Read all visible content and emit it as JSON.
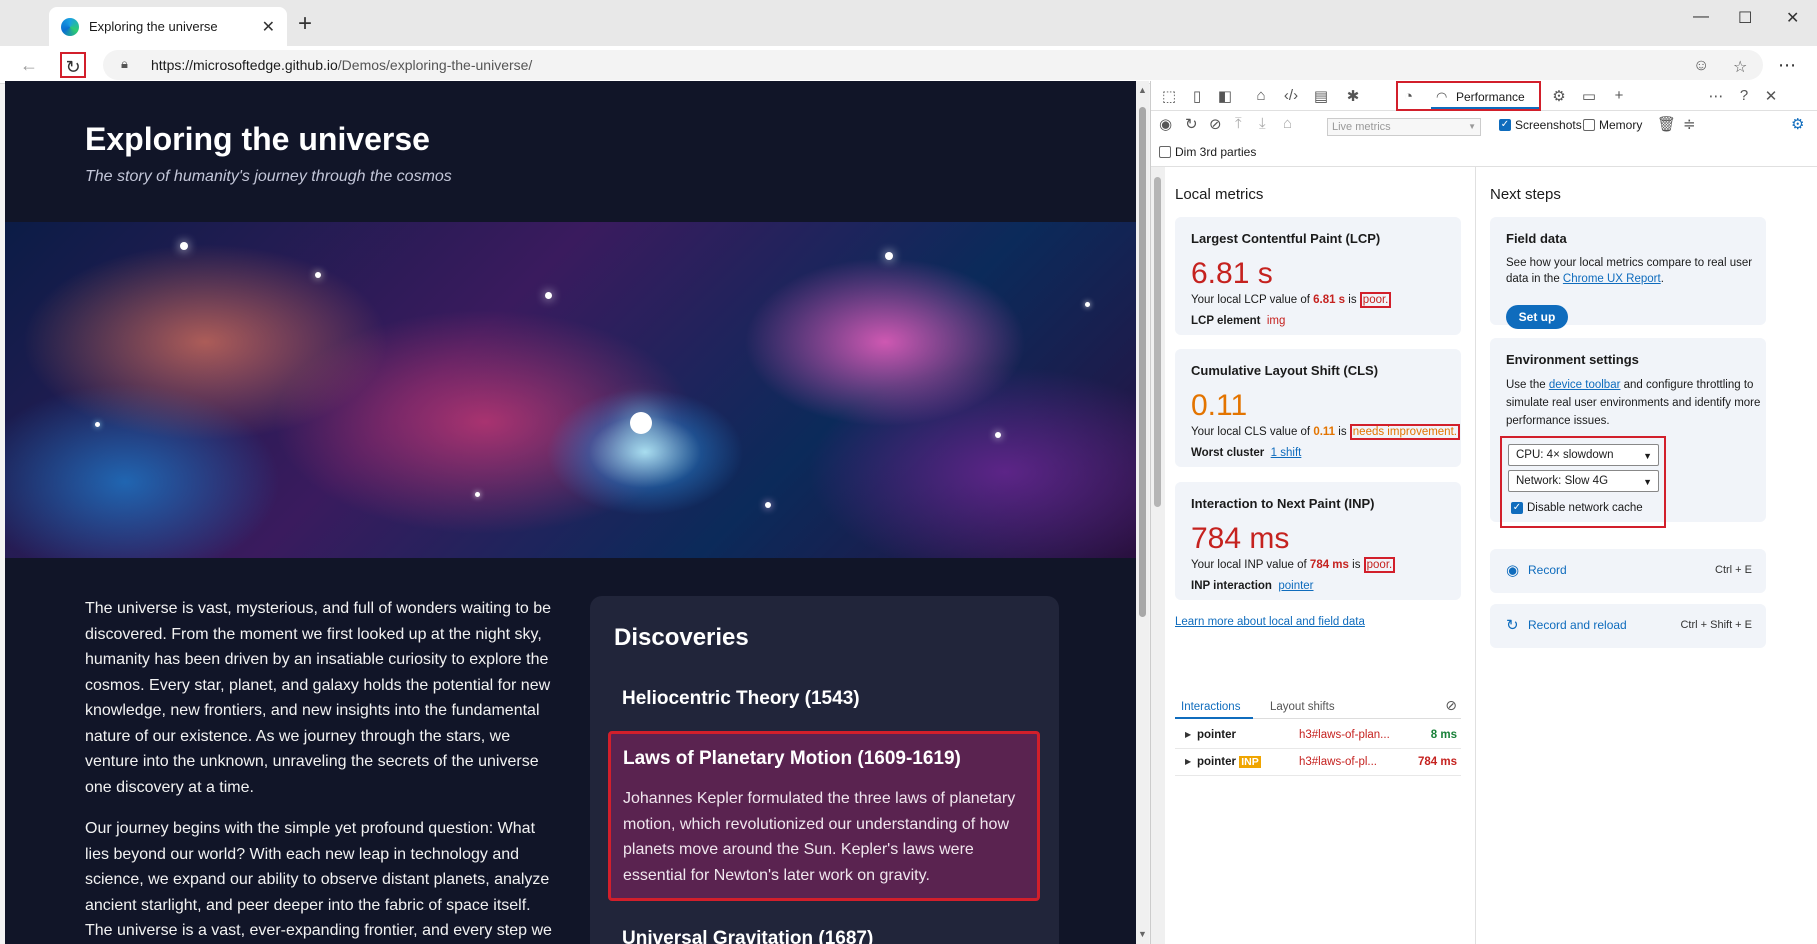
{
  "browser": {
    "tab_title": "Exploring the universe",
    "tab_close": "✕",
    "new_tab": "+",
    "win_minimize": "—",
    "win_maximize": "☐",
    "win_close": "✕",
    "url_host": "https://microsoftedge.github.io",
    "url_path": "/Demos/exploring-the-universe/",
    "back": "←",
    "refresh": "↻",
    "more": "⋯"
  },
  "page": {
    "title": "Exploring the universe",
    "subtitle": "The story of humanity's journey through the cosmos",
    "para1": "The universe is vast, mysterious, and full of wonders waiting to be discovered. From the moment we first looked up at the night sky, humanity has been driven by an insatiable curiosity to explore the cosmos. Every star, planet, and galaxy holds the potential for new knowledge, new frontiers, and new insights into the fundamental nature of our existence. As we journey through the stars, we venture into the unknown, unraveling the secrets of the universe one discovery at a time.",
    "para2": "Our journey begins with the simple yet profound question: What lies beyond our world? With each new leap in technology and science, we expand our ability to observe distant planets, analyze ancient starlight, and peer deeper into the fabric of space itself. The universe is a vast, ever-expanding frontier, and every step we",
    "discoveries": {
      "heading": "Discoveries",
      "item1": "Heliocentric Theory (1543)",
      "item2_title": "Laws of Planetary Motion (1609-1619)",
      "item2_text": "Johannes Kepler formulated the three laws of planetary motion, which revolutionized our understanding of how planets move around the Sun. Kepler's laws were essential for Newton's later work on gravity.",
      "item3": "Universal Gravitation (1687)"
    }
  },
  "devtools": {
    "perf_tab_label": "Performance",
    "live_metrics_placeholder": "Live metrics",
    "screenshots_label": "Screenshots",
    "memory_label": "Memory",
    "dim3p_label": "Dim 3rd parties",
    "local_metrics_title": "Local metrics",
    "lcp": {
      "title": "Largest Contentful Paint (LCP)",
      "value": "6.81 s",
      "desc_prefix": "Your local LCP value of ",
      "desc_value": "6.81 s",
      "desc_mid": " is ",
      "rating": "poor.",
      "sub_label": "LCP element",
      "sub_value": "img"
    },
    "cls": {
      "title": "Cumulative Layout Shift (CLS)",
      "value": "0.11",
      "desc_prefix": "Your local CLS value of ",
      "desc_value": "0.11",
      "desc_mid": " is ",
      "rating": "needs improvement.",
      "sub_label": "Worst cluster",
      "sub_value": "1 shift"
    },
    "inp": {
      "title": "Interaction to Next Paint (INP)",
      "value": "784 ms",
      "desc_prefix": "Your local INP value of ",
      "desc_value": "784 ms",
      "desc_mid": " is ",
      "rating": "poor.",
      "sub_label": "INP interaction",
      "sub_value": "pointer"
    },
    "learn_more": "Learn more about local and field data",
    "tabs": {
      "interactions": "Interactions",
      "layout_shifts": "Layout shifts"
    },
    "interactions": [
      {
        "name": "pointer",
        "badge": "",
        "selector": "h3#laws-of-plan...",
        "duration": "8 ms",
        "color": "#188038"
      },
      {
        "name": "pointer",
        "badge": "INP",
        "selector": "h3#laws-of-pl...",
        "duration": "784 ms",
        "color": "#c5221f"
      }
    ],
    "next_steps_title": "Next steps",
    "field_data": {
      "title": "Field data",
      "text_prefix": "See how your local metrics compare to real user data in the ",
      "link": "Chrome UX Report",
      "text_suffix": ".",
      "button": "Set up"
    },
    "env": {
      "title": "Environment settings",
      "text_prefix": "Use the ",
      "link": "device toolbar",
      "text_suffix": " and configure throttling to simulate real user environments and identify more performance issues.",
      "cpu": "CPU: 4× slowdown",
      "network": "Network: Slow 4G",
      "cache_label": "Disable network cache"
    },
    "record": {
      "label": "Record",
      "shortcut": "Ctrl + E"
    },
    "record_reload": {
      "label": "Record and reload",
      "shortcut": "Ctrl + Shift + E"
    }
  },
  "colors": {
    "accent": "#0f6cbd",
    "highlight_border": "#d21f2b",
    "poor": "#c5221f",
    "needs_improvement": "#e37400",
    "page_bg": "#111528"
  }
}
